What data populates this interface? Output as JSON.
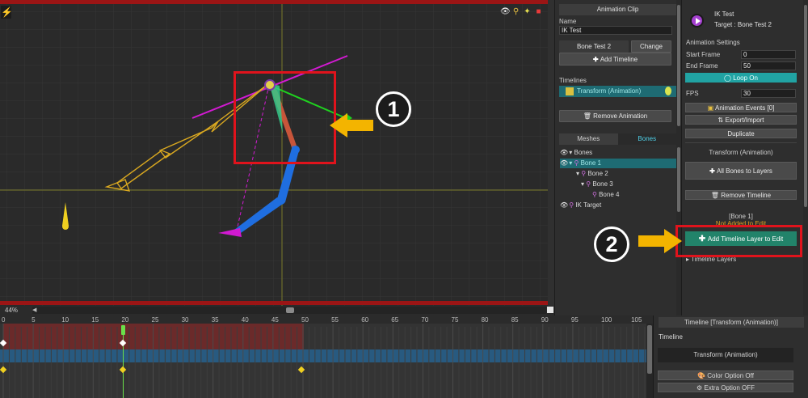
{
  "viewport": {
    "zoom": "44%",
    "top_icons": [
      "eye-icon",
      "bone-icon",
      "lightbulb-icon",
      "record-icon"
    ]
  },
  "anim_panel": {
    "header": "Animation Clip",
    "name_label": "Name",
    "name_value": "IK Test",
    "target_value": "Bone Test 2",
    "change_label": "Change",
    "add_timeline_label": "Add Timeline",
    "timelines_label": "Timelines",
    "timeline_item": "Transform (Animation)",
    "remove_animation_label": "Remove Animation",
    "tabs": [
      "Meshes",
      "Bones"
    ],
    "active_tab": "Bones",
    "tree": [
      {
        "label": "Bones",
        "indent": 0
      },
      {
        "label": "Bone 1",
        "indent": 1,
        "selected": true
      },
      {
        "label": "Bone 2",
        "indent": 2
      },
      {
        "label": "Bone 3",
        "indent": 3
      },
      {
        "label": "Bone 4",
        "indent": 4
      },
      {
        "label": "IK Target",
        "indent": 1
      }
    ]
  },
  "right_panel": {
    "title": "IK Test",
    "target": "Target : Bone Test 2",
    "settings_label": "Animation Settings",
    "start_frame_label": "Start Frame",
    "start_frame_value": "0",
    "end_frame_label": "End Frame",
    "end_frame_value": "50",
    "loop_label": "Loop On",
    "fps_label": "FPS",
    "fps_value": "30",
    "events_label": "Animation Events [0]",
    "export_label": "Export/Import",
    "duplicate_label": "Duplicate",
    "timeline_title": "Transform (Animation)",
    "all_bones_label": "All Bones to Layers",
    "remove_timeline_label": "Remove Timeline",
    "bone_name": "[Bone 1]",
    "not_added": "Not Added to Edit",
    "add_layer_label": "Add Timeline Layer to Edit",
    "timeline_layers_label": "Timeline Layers"
  },
  "timeline": {
    "ticks": [
      "0",
      "5",
      "10",
      "15",
      "20",
      "25",
      "30",
      "35",
      "40",
      "45",
      "50",
      "55",
      "60",
      "65",
      "70",
      "75",
      "80",
      "85",
      "90",
      "95",
      "100",
      "105"
    ],
    "current_frame": 20,
    "header": "Timeline [Transform (Animation)]",
    "label": "Timeline",
    "layer_name": "Transform (Animation)",
    "color_option": "Color Option Off",
    "extra_option": "Extra Option OFF"
  },
  "annotations": {
    "badge1": "1",
    "badge2": "2"
  }
}
